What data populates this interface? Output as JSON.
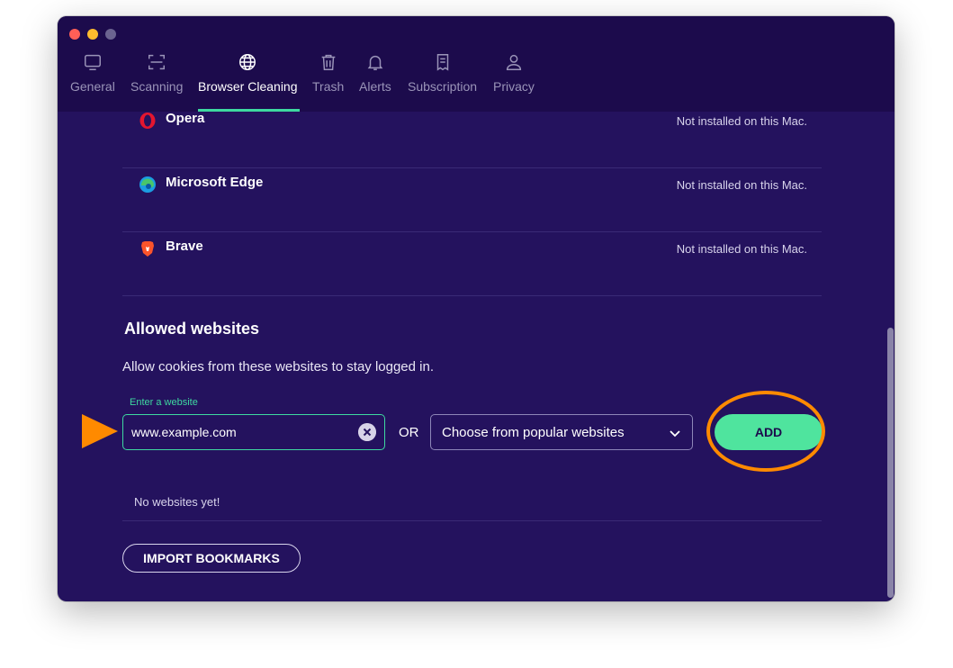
{
  "tabs": [
    {
      "label": "General",
      "icon": "monitor-icon"
    },
    {
      "label": "Scanning",
      "icon": "scan-icon"
    },
    {
      "label": "Browser Cleaning",
      "icon": "globe-icon"
    },
    {
      "label": "Trash",
      "icon": "trash-icon"
    },
    {
      "label": "Alerts",
      "icon": "bell-icon"
    },
    {
      "label": "Subscription",
      "icon": "receipt-icon"
    },
    {
      "label": "Privacy",
      "icon": "person-icon"
    }
  ],
  "active_tab": "Browser Cleaning",
  "browsers": [
    {
      "name": "Opera",
      "status": "Not installed on this Mac.",
      "icon": "opera-icon"
    },
    {
      "name": "Microsoft Edge",
      "status": "Not installed on this Mac.",
      "icon": "edge-icon"
    },
    {
      "name": "Brave",
      "status": "Not installed on this Mac.",
      "icon": "brave-icon"
    }
  ],
  "allowed": {
    "title": "Allowed websites",
    "description": "Allow cookies from these websites to stay logged in.",
    "input_label": "Enter a website",
    "input_value": "www.example.com",
    "or_label": "OR",
    "select_value": "Choose from popular websites",
    "add_label": "ADD",
    "empty_text": "No websites yet!",
    "import_label": "IMPORT BOOKMARKS"
  },
  "colors": {
    "background": "#24125e",
    "titlebar": "#1c0b4c",
    "accent": "#3ed9a0",
    "add_button": "#4fe49e",
    "annotation": "#ff8a00"
  }
}
